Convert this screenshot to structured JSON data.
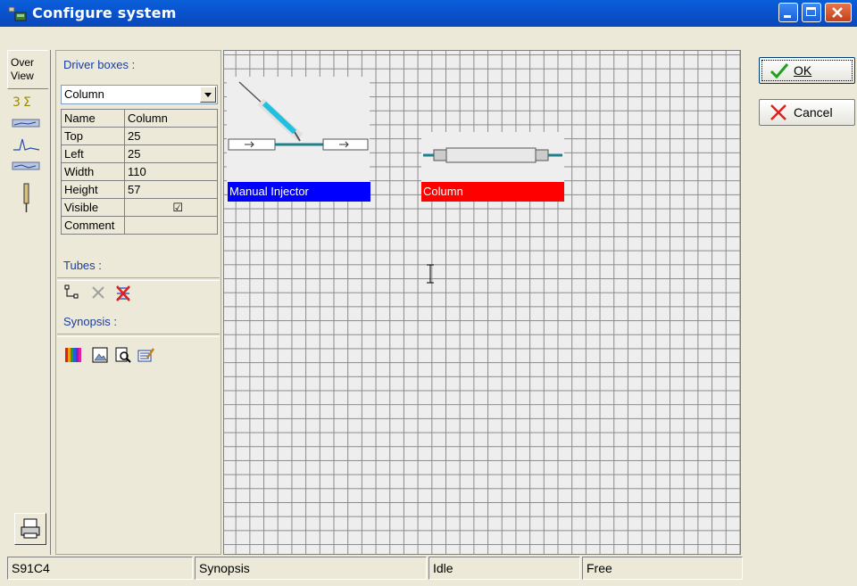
{
  "window": {
    "title": "Configure system"
  },
  "tabs": {
    "overview_label_line1": "Over",
    "overview_label_line2": "View"
  },
  "panel": {
    "driver_boxes_label": "Driver boxes :",
    "selected_driver": "Column",
    "properties": [
      {
        "name": "Name",
        "value": "Column"
      },
      {
        "name": "Top",
        "value": "25"
      },
      {
        "name": "Left",
        "value": "25"
      },
      {
        "name": "Width",
        "value": "110"
      },
      {
        "name": "Height",
        "value": "57"
      },
      {
        "name": "Visible",
        "value": "☑"
      },
      {
        "name": "Comment",
        "value": ""
      }
    ],
    "tubes_label": "Tubes :",
    "synopsis_label": "Synopsis :"
  },
  "canvas": {
    "devices": [
      {
        "label": "Manual Injector",
        "color": "#0000ff",
        "icon": "manual-injector-icon"
      },
      {
        "label": "Column",
        "color": "#ff0000",
        "icon": "column-icon"
      }
    ]
  },
  "buttons": {
    "ok_label": "OK",
    "cancel_label": "Cancel"
  },
  "status_bar": {
    "id": "S91C4",
    "view": "Synopsis",
    "state": "Idle",
    "mode": "Free"
  }
}
